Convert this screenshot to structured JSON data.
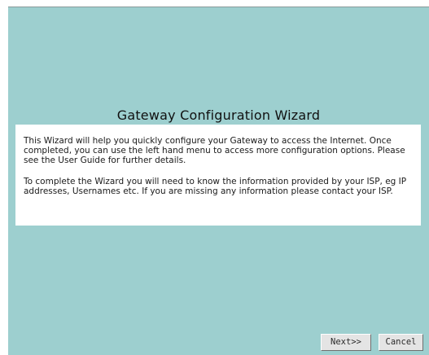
{
  "wizard": {
    "title": "Gateway Configuration Wizard",
    "paragraph_1": "This Wizard will help you quickly configure your Gateway to access the Internet. Once completed, you can use the left hand menu to access more configuration options. Please see the User Guide for further details.",
    "paragraph_2": "To complete the Wizard you will need to know the information provided by your ISP, eg IP addresses, Usernames etc. If you are missing any information please contact your ISP."
  },
  "buttons": {
    "next_label": "Next>>",
    "cancel_label": "Cancel"
  },
  "colors": {
    "panel_background": "#9dcfcf",
    "content_background": "#ffffff",
    "button_face": "#e4e4e4"
  }
}
